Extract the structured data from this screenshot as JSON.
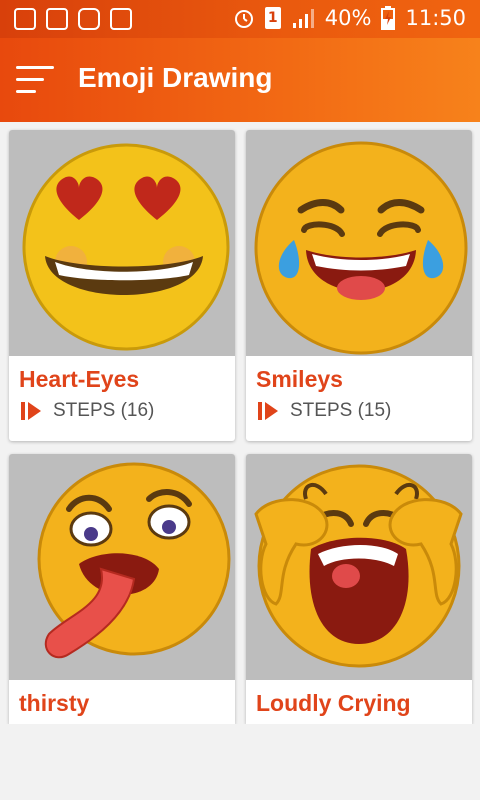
{
  "status_bar": {
    "battery": "40%",
    "time": "11:50",
    "sim_slot": "1"
  },
  "app_bar": {
    "title": "Emoji Drawing"
  },
  "cards": [
    {
      "title": "Heart-Eyes",
      "steps": "STEPS (16)",
      "emoji": "heart-eyes-emoji"
    },
    {
      "title": "Smileys",
      "steps": "STEPS (15)",
      "emoji": "tears-of-joy-emoji"
    },
    {
      "title": "thirsty",
      "steps": "",
      "emoji": "thirsty-emoji"
    },
    {
      "title": "Loudly Crying",
      "steps": "",
      "emoji": "loudly-crying-emoji"
    }
  ],
  "colors": {
    "accent": "#e0441a",
    "appbar": "#f26a14",
    "card_image_bg": "#bdbdbd"
  }
}
